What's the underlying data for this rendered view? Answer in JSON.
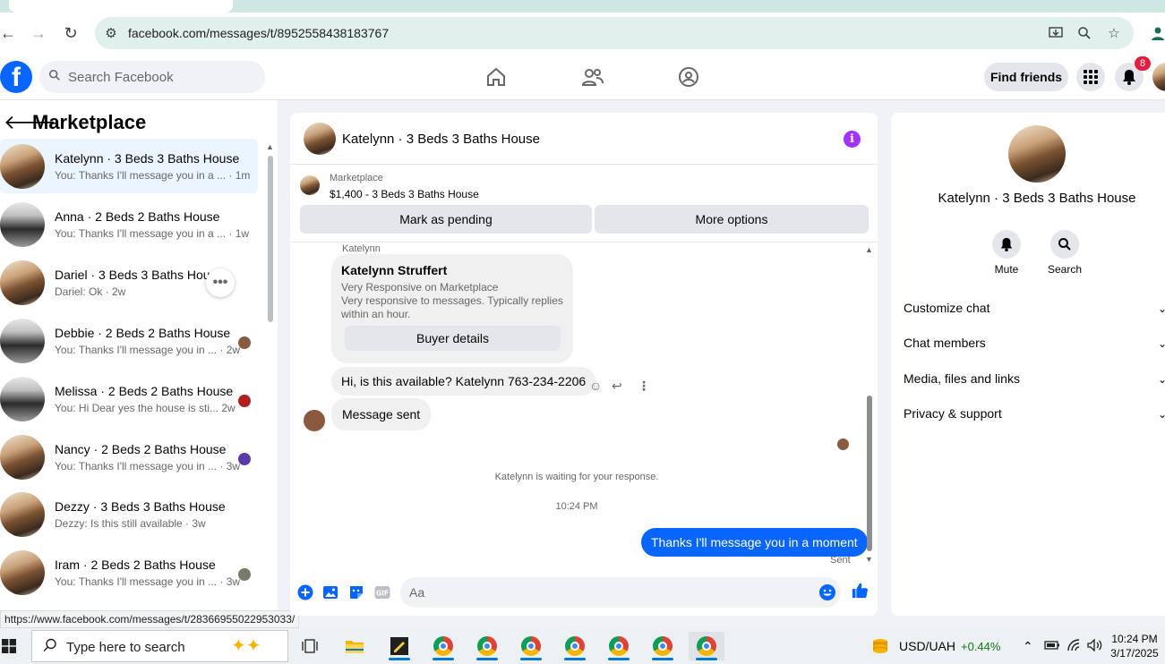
{
  "browser": {
    "url": "facebook.com/messages/t/8952558438183767",
    "status_url": "https://www.facebook.com/messages/t/28366955022953033/"
  },
  "header": {
    "search_placeholder": "Search Facebook",
    "find_friends": "Find friends",
    "notification_count": "8"
  },
  "sidebar": {
    "title": "Marketplace",
    "conversations": [
      {
        "name": "Katelynn · 3 Beds 3 Baths House",
        "snippet": "You: Thanks I'll message you in a ... · 1m"
      },
      {
        "name": "Anna · 2 Beds 2 Baths House",
        "snippet": "You: Thanks I'll message you in a ... · 1w"
      },
      {
        "name": "Dariel · 3 Beds 3 Baths Hous",
        "snippet": "Dariel: Ok · 2w"
      },
      {
        "name": "Debbie · 2 Beds 2 Baths House",
        "snippet": "You: Thanks I'll message you in ... · 2w"
      },
      {
        "name": "Melissa · 2 Beds 2 Baths House",
        "snippet": "You: Hi Dear yes the house is sti... 2w"
      },
      {
        "name": "Nancy · 2 Beds 2 Baths House",
        "snippet": "You: Thanks I'll message you in ... · 3w"
      },
      {
        "name": "Dezzy · 3 Beds 3 Baths House",
        "snippet": "Dezzy: Is this still available · 3w"
      },
      {
        "name": "Iram · 2 Beds 2 Baths House",
        "snippet": "You: Thanks I'll message you in ... · 3w"
      }
    ]
  },
  "chat": {
    "title": "Katelynn · 3 Beds 3 Baths House",
    "marketplace_label": "Marketplace",
    "listing": "$1,400 - 3 Beds 3 Baths House",
    "mark_pending": "Mark as pending",
    "more_options": "More options",
    "sender_label": "Katelynn",
    "card_name": "Katelynn Struffert",
    "card_desc_1": "Very Responsive on Marketplace",
    "card_desc_2": "Very responsive to messages. Typically replies within an hour.",
    "buyer_details": "Buyer details",
    "msg_1": "Hi, is this available? Katelynn 763-234-2206",
    "msg_2": "Message sent",
    "waiting": "Katelynn is waiting for your response.",
    "time": "10:24 PM",
    "my_msg": "Thanks I'll message you in a moment",
    "sent": "Sent",
    "composer_placeholder": "Aa"
  },
  "details": {
    "name": "Katelynn · 3 Beds 3 Baths House",
    "mute": "Mute",
    "search": "Search",
    "items": [
      "Customize chat",
      "Chat members",
      "Media, files and links",
      "Privacy & support"
    ]
  },
  "taskbar": {
    "search_placeholder": "Type here to search",
    "currency": "USD/UAH",
    "change": "+0.44%",
    "time": "10:24 PM",
    "date": "3/17/2025"
  },
  "colors": {
    "facebook_blue": "#0866ff",
    "info_purple": "#a033ff",
    "badge_red": "#e41e3f",
    "positive_green": "#0f7b0f"
  }
}
